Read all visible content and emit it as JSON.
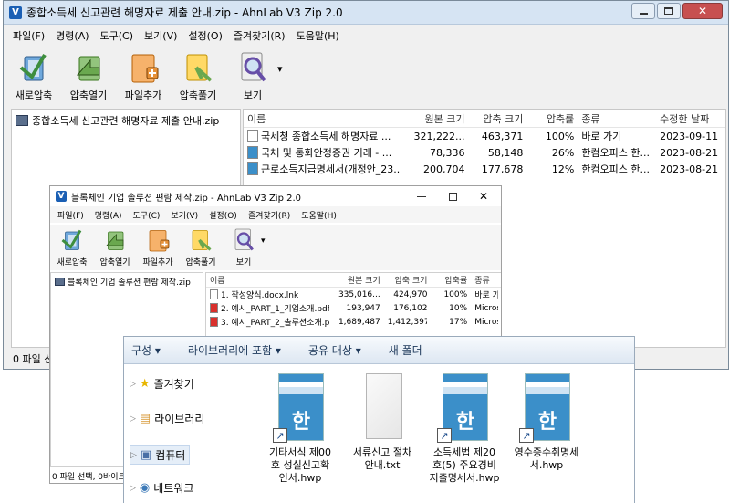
{
  "main_window": {
    "title": "종합소득세 신고관련 해명자료 제출 안내.zip - AhnLab V3 Zip 2.0",
    "menu": [
      "파일(F)",
      "명령(A)",
      "도구(C)",
      "보기(V)",
      "설정(O)",
      "즐겨찾기(R)",
      "도움말(H)"
    ],
    "toolbar": [
      "새로압축",
      "압축열기",
      "파일추가",
      "압축풀기",
      "보기"
    ],
    "tree_item": "종합소득세 신고관련 해명자료 제출 안내.zip",
    "columns": [
      "이름",
      "원본 크기",
      "압축 크기",
      "압축률",
      "종류",
      "수정한 날짜"
    ],
    "files": [
      {
        "name": "국세청 종합소득세 해명자료 ...",
        "orig": "321,222...",
        "comp": "463,371",
        "ratio": "100%",
        "type": "바로 가기",
        "date": "2023-09-11 ..."
      },
      {
        "name": "국채 및 통화안정증권 거래 - ...",
        "orig": "78,336",
        "comp": "58,148",
        "ratio": "26%",
        "type": "한컴오피스 한...",
        "date": "2023-08-21 ..."
      },
      {
        "name": "근로소득지급명세서(개정안_23...",
        "orig": "200,704",
        "comp": "177,678",
        "ratio": "12%",
        "type": "한컴오피스 한...",
        "date": "2023-08-21 ..."
      }
    ],
    "status": "0 파일 선"
  },
  "second_window": {
    "title": "블록체인 기업 솔루션 편람 제작.zip - AhnLab V3 Zip 2.0",
    "menu": [
      "파일(F)",
      "명령(A)",
      "도구(C)",
      "보기(V)",
      "설정(O)",
      "즐겨찾기(R)",
      "도움말(H)"
    ],
    "toolbar": [
      "새로압축",
      "압축열기",
      "파일추가",
      "압축풀기",
      "보기"
    ],
    "tree_item": "블록체인 기업 솔루션 편람 제작.zip",
    "columns": [
      "이름",
      "원본 크기",
      "압축 크기",
      "압축률",
      "종류"
    ],
    "files": [
      {
        "name": "1. 작성양식.docx.lnk",
        "orig": "335,016...",
        "comp": "424,970",
        "ratio": "100%",
        "type": "바로 가"
      },
      {
        "name": "2. 예시_PART_1_기업소개.pdf",
        "orig": "193,947",
        "comp": "176,102",
        "ratio": "10%",
        "type": "Microso"
      },
      {
        "name": "3. 예시_PART_2_솔루션소개.pdf",
        "orig": "1,689,487",
        "comp": "1,412,397",
        "ratio": "17%",
        "type": "Microso"
      }
    ],
    "status": "0 파일 선택, 0바이트"
  },
  "explorer": {
    "toolbar": [
      "구성 ▾",
      "라이브러리에 포함 ▾",
      "공유 대상 ▾",
      "새 폴더"
    ],
    "nav": [
      "즐겨찾기",
      "라이브러리",
      "컴퓨터",
      "네트워크"
    ],
    "files": [
      {
        "label": "기타서식 제00\n호 성실신고확\n인서.hwp",
        "kind": "hwp"
      },
      {
        "label": "서류신고 절차\n안내.txt",
        "kind": "txt"
      },
      {
        "label": "소득세법 제20\n호(5) 주요경비\n지출명세서.hwp",
        "kind": "hwp"
      },
      {
        "label": "영수증수취명세\n서.hwp",
        "kind": "hwp"
      }
    ]
  },
  "colors": {
    "accent": "#1a5fb4",
    "close_red": "#c75050",
    "hwp_blue": "#3b8fc9"
  }
}
